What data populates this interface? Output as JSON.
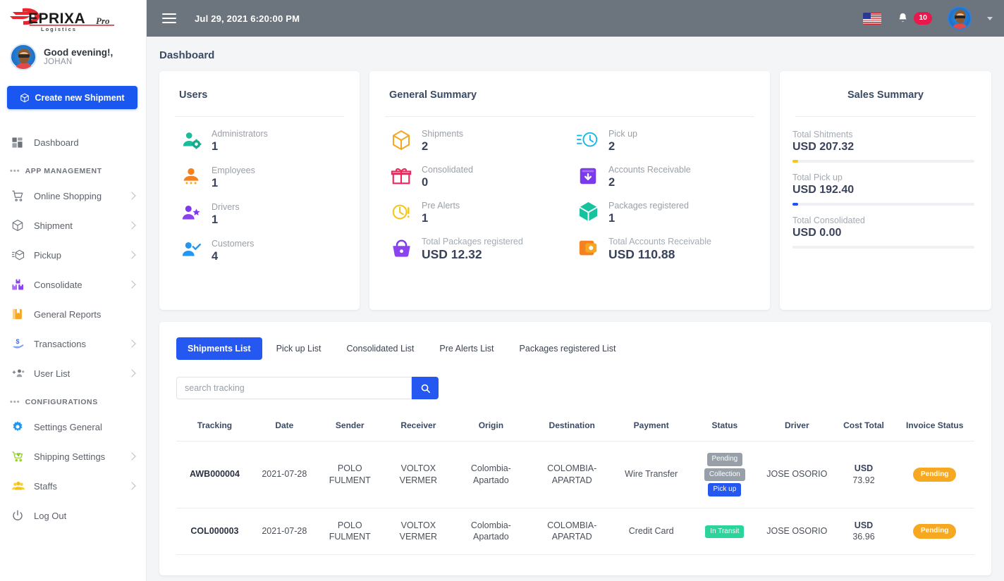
{
  "brand": {
    "name": "DEPRIXA",
    "suffix": "Pro",
    "tagline": "Logistics"
  },
  "sidebar": {
    "greeting": "Good evening!,",
    "username": "JOHAN",
    "create_button": "Create new Shipment",
    "dashboard_label": "Dashboard",
    "section_app": "APP MANAGEMENT",
    "section_config": "CONFIGURATIONS",
    "app_items": [
      {
        "label": "Online Shopping",
        "icon": "cart-icon",
        "chevron": true
      },
      {
        "label": "Shipment",
        "icon": "box-icon",
        "chevron": true
      },
      {
        "label": "Pickup",
        "icon": "pickup-icon",
        "chevron": true
      },
      {
        "label": "Consolidate",
        "icon": "consolidate-icon",
        "chevron": true
      },
      {
        "label": "General Reports",
        "icon": "reports-icon",
        "chevron": false
      },
      {
        "label": "Transactions",
        "icon": "transactions-icon",
        "chevron": true
      },
      {
        "label": "User List",
        "icon": "user-list-icon",
        "chevron": true
      }
    ],
    "config_items": [
      {
        "label": "Settings General",
        "icon": "gear-icon",
        "chevron": false
      },
      {
        "label": "Shipping Settings",
        "icon": "shipping-cart-icon",
        "chevron": true
      },
      {
        "label": "Staffs",
        "icon": "staffs-icon",
        "chevron": true
      },
      {
        "label": "Log Out",
        "icon": "power-icon",
        "chevron": false
      }
    ]
  },
  "topbar": {
    "datetime": "Jul 29, 2021 6:20:00 PM",
    "notification_count": "10",
    "flag": "us-flag-icon"
  },
  "page": {
    "title": "Dashboard"
  },
  "users_card": {
    "title": "Users",
    "items": [
      {
        "label": "Administrators",
        "value": "1",
        "icon": "user-gear-icon",
        "color": "#1abc9c"
      },
      {
        "label": "Employees",
        "value": "1",
        "icon": "user-tie-icon",
        "color": "#f58220"
      },
      {
        "label": "Drivers",
        "value": "1",
        "icon": "user-star-icon",
        "color": "#7c3aed"
      },
      {
        "label": "Customers",
        "value": "4",
        "icon": "user-check-icon",
        "color": "#2196f3"
      }
    ]
  },
  "general_card": {
    "title": "General Summary",
    "items": [
      {
        "label": "Shipments",
        "value": "2",
        "icon": "package-icon",
        "color": "#f5a623",
        "dim": false
      },
      {
        "label": "Pick up",
        "value": "2",
        "icon": "clock-pickup-icon",
        "color": "#15b7e8",
        "dim": false
      },
      {
        "label": "Consolidated",
        "value": "0",
        "icon": "gift-icon",
        "color": "#f0245b",
        "dim": false
      },
      {
        "label": "Accounts Receivable",
        "value": "2",
        "icon": "download-box-icon",
        "color": "#7c3aed",
        "dim": false
      },
      {
        "label": "Pre Alerts",
        "value": "1",
        "icon": "clock-alert-icon",
        "color": "#f5c518",
        "dim": false
      },
      {
        "label": "Packages registered",
        "value": "1",
        "icon": "cube-icon",
        "color": "#17c39e",
        "dim": false
      },
      {
        "label": "Total Packages registered",
        "value": "USD 12.32",
        "icon": "basket-icon",
        "color": "#7c3aed",
        "dim": true
      },
      {
        "label": "Total Accounts Receivable",
        "value": "USD 110.88",
        "icon": "wallet-icon",
        "color": "#f58220",
        "dim": true
      }
    ]
  },
  "sales_card": {
    "title": "Sales Summary",
    "items": [
      {
        "label": "Total Shitments",
        "value": "USD 207.32",
        "bar_color": "#f5c518",
        "bar_pct": 3
      },
      {
        "label": "Total Pick up",
        "value": "USD 192.40",
        "bar_color": "#1a56f0",
        "bar_pct": 3
      },
      {
        "label": "Total Consolidated",
        "value": "USD 0.00",
        "bar_color": "#e8eaed",
        "bar_pct": 0
      }
    ]
  },
  "list_section": {
    "tabs": [
      {
        "label": "Shipments List",
        "active": true
      },
      {
        "label": "Pick up List",
        "active": false
      },
      {
        "label": "Consolidated List",
        "active": false
      },
      {
        "label": "Pre Alerts List",
        "active": false
      },
      {
        "label": "Packages registered List",
        "active": false
      }
    ],
    "search": {
      "value": "",
      "placeholder": "search tracking",
      "button_icon": "search-icon"
    },
    "columns": [
      "Tracking",
      "Date",
      "Sender",
      "Receiver",
      "Origin",
      "Destination",
      "Payment",
      "Status",
      "Driver",
      "Cost Total",
      "Invoice Status"
    ],
    "rows": [
      {
        "tracking": "AWB000004",
        "date": "2021-07-28",
        "sender": "POLO FULMENT",
        "receiver": "VOLTOX VERMER",
        "origin": "Colombia-Apartado",
        "destination": "COLOMBIA-APARTAD",
        "payment": "Wire Transfer",
        "status": [
          {
            "text": "Pending",
            "style": "gray"
          },
          {
            "text": "Collection",
            "style": "gray"
          },
          {
            "text": "Pick up",
            "style": "blue"
          }
        ],
        "driver": "JOSE OSORIO",
        "cost_currency": "USD",
        "cost_amount": "73.92",
        "invoice_status": "Pending"
      },
      {
        "tracking": "COL000003",
        "date": "2021-07-28",
        "sender": "POLO FULMENT",
        "receiver": "VOLTOX VERMER",
        "origin": "Colombia-Apartado",
        "destination": "COLOMBIA-APARTAD",
        "payment": "Credit Card",
        "status": [
          {
            "text": "In Transit",
            "style": "green"
          }
        ],
        "driver": "JOSE OSORIO",
        "cost_currency": "USD",
        "cost_amount": "36.96",
        "invoice_status": "Pending"
      }
    ]
  }
}
